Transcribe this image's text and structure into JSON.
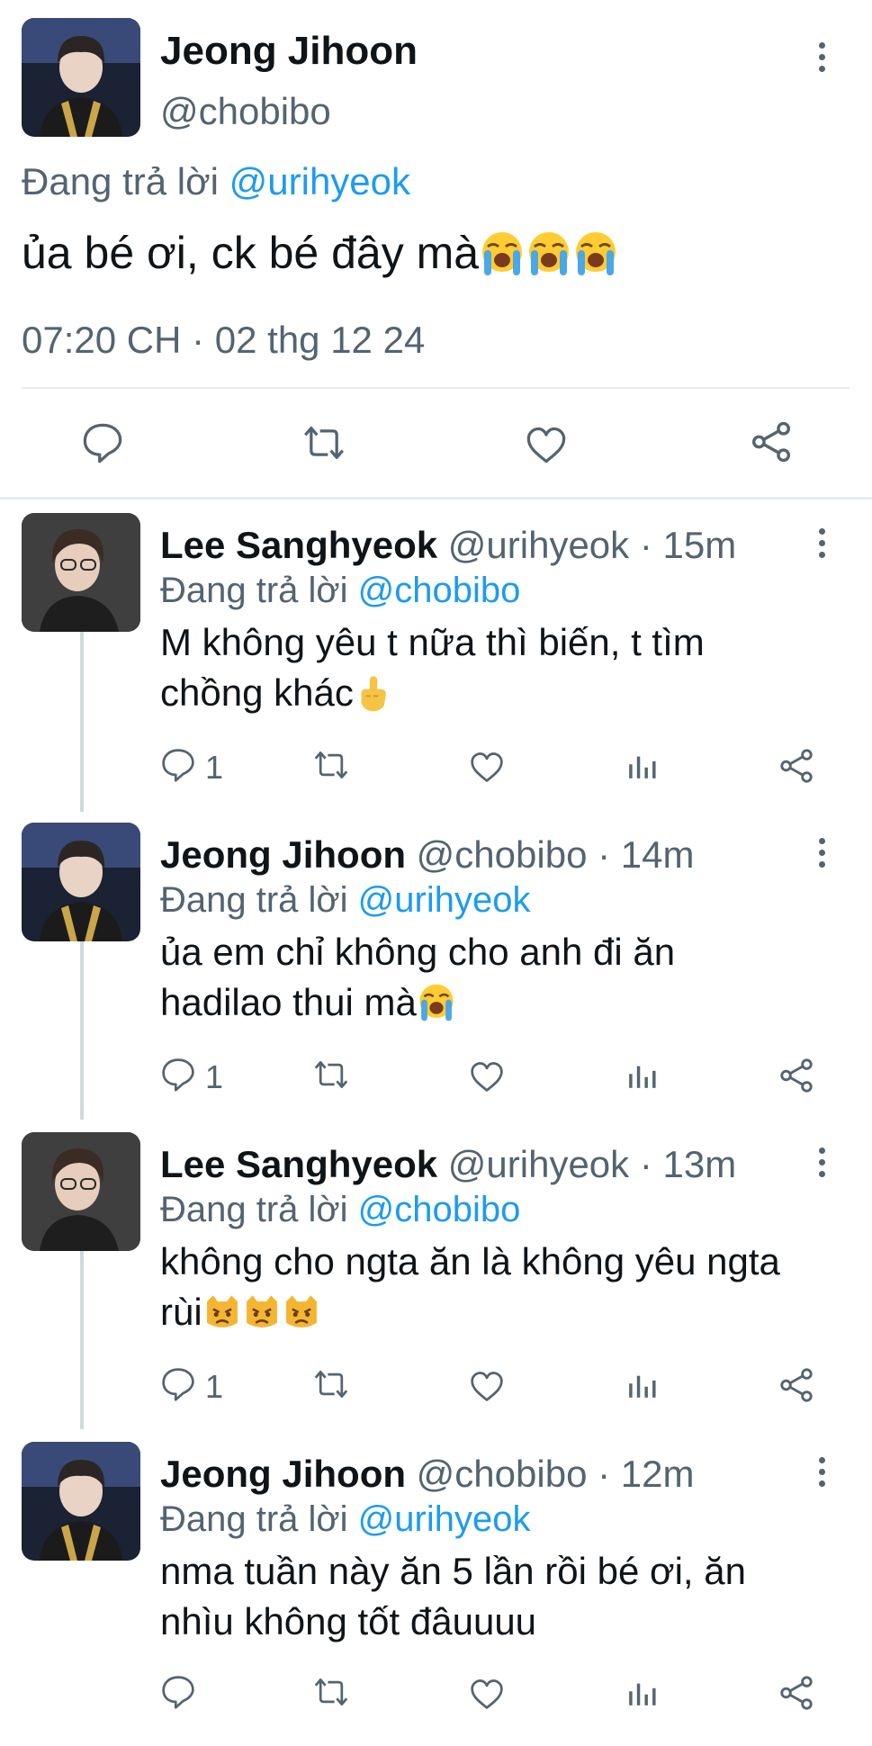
{
  "main_tweet": {
    "author_name": "Jeong Jihoon",
    "author_handle": "@chobibo",
    "reply_prefix": "Đang trả lời ",
    "reply_mention": "@urihyeok",
    "text": "ủa bé ơi, ck bé đây mà",
    "text_emojis": [
      "loudly-crying-face",
      "loudly-crying-face",
      "loudly-crying-face"
    ],
    "timestamp": "07:20 CH · 02 thg 12 24",
    "actions": [
      "reply-icon",
      "retweet-icon",
      "like-icon",
      "share-icon"
    ]
  },
  "replies": [
    {
      "author_name": "Lee Sanghyeok",
      "author_handle": "@urihyeok",
      "time": "· 15m",
      "reply_prefix": "Đang trả lời ",
      "reply_mention": "@chobibo",
      "line1": "M không yêu t nữa thì biến, t tìm",
      "line2": "chồng khác",
      "emojis": [
        "middle-finger"
      ],
      "reply_count": "1"
    },
    {
      "author_name": "Jeong Jihoon",
      "author_handle": "@chobibo",
      "time": "· 14m",
      "reply_prefix": "Đang trả lời ",
      "reply_mention": "@urihyeok",
      "line1": "ủa em chỉ không cho anh đi ăn",
      "line2": "hadilao thui mà",
      "emojis": [
        "loudly-crying-face"
      ],
      "reply_count": "1"
    },
    {
      "author_name": "Lee Sanghyeok",
      "author_handle": "@urihyeok",
      "time": "· 13m",
      "reply_prefix": "Đang trả lời ",
      "reply_mention": "@chobibo",
      "line1": "không cho ngta ăn là không yêu ngta",
      "line2": "rùi",
      "emojis": [
        "pouting-cat",
        "pouting-cat",
        "pouting-cat"
      ],
      "reply_count": "1"
    },
    {
      "author_name": "Jeong Jihoon",
      "author_handle": "@chobibo",
      "time": "· 12m",
      "reply_prefix": "Đang trả lời ",
      "reply_mention": "@urihyeok",
      "line1": "nma tuần này ăn 5 lần rồi bé ơi, ăn",
      "line2": "nhìu không tốt đâuuuu",
      "emojis": [],
      "reply_count": ""
    }
  ],
  "colors": {
    "text": "#0f1419",
    "secondary": "#536471",
    "mention": "#1d9bf0",
    "divider": "#e6ecf0"
  }
}
